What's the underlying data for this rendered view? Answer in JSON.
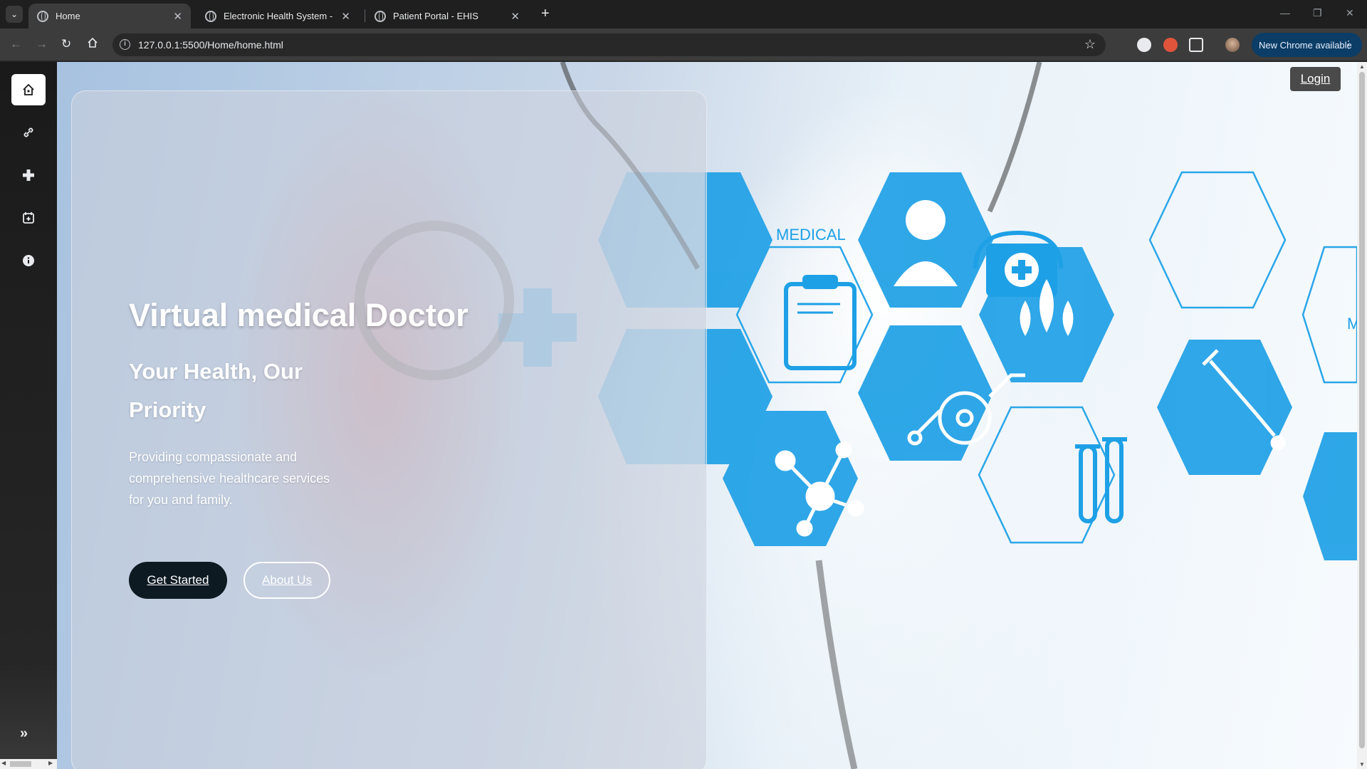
{
  "browser": {
    "tabs": [
      {
        "title": "Home",
        "close": "✕"
      },
      {
        "title": "Electronic Health System - Login",
        "close": "✕"
      },
      {
        "title": "Patient Portal - EHIS",
        "close": "✕"
      }
    ],
    "new_tab": "+",
    "url": "127.0.0.1:5500/Home/home.html",
    "new_chrome_label": "New Chrome available",
    "window_controls": [
      "—",
      "❐",
      "✕"
    ]
  },
  "sidebar": {
    "items": [
      {
        "icon": "home-icon",
        "active": true
      },
      {
        "icon": "link-icon",
        "active": false
      },
      {
        "icon": "plus-icon",
        "active": false
      },
      {
        "icon": "calendar-add-icon",
        "active": false
      },
      {
        "icon": "info-icon",
        "active": false
      }
    ],
    "expand_label": "»"
  },
  "header": {
    "login_label": "Login"
  },
  "hero": {
    "title": "Virtual medical Doctor",
    "subtitle": "Your Health, Our Priority",
    "description": "Providing compassionate and comprehensive healthcare services for you and family.",
    "primary_button": "Get Started",
    "secondary_button": "About Us"
  },
  "background": {
    "hex_text": "MEDICAL",
    "edge_text": "M",
    "accent_color": "#1ea0e6"
  }
}
